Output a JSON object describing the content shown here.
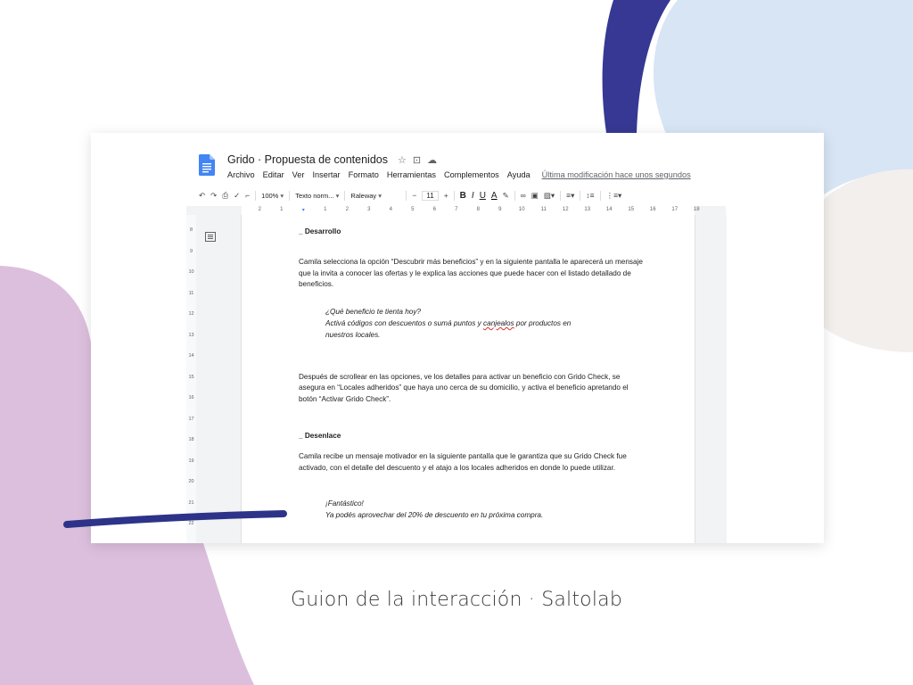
{
  "document": {
    "title": "Grido · Propuesta de contenidos",
    "title_icons": [
      "star-icon",
      "folder-icon",
      "cloud-icon"
    ],
    "menu": [
      "Archivo",
      "Editar",
      "Ver",
      "Insertar",
      "Formato",
      "Herramientas",
      "Complementos",
      "Ayuda"
    ],
    "last_modified": "Última modificación hace unos segundos"
  },
  "toolbar": {
    "zoom": "100%",
    "style": "Texto norm...",
    "font": "Raleway",
    "font_size": "11",
    "minus": "−",
    "plus": "+",
    "bold": "B",
    "italic": "I",
    "underline": "U",
    "text_color": "A"
  },
  "ruler": {
    "top": [
      "2",
      "1",
      "",
      "1",
      "2",
      "3",
      "4",
      "5",
      "6",
      "7",
      "8",
      "9",
      "10",
      "11",
      "12",
      "13",
      "14",
      "15",
      "16",
      "17",
      "18"
    ],
    "left": [
      "8",
      "9",
      "10",
      "11",
      "12",
      "13",
      "14",
      "15",
      "16",
      "17",
      "18",
      "19",
      "20",
      "21",
      "22"
    ]
  },
  "content": {
    "h_desarrollo": "_ Desarrollo",
    "p1": "Camila selecciona la opción “Descubrir más beneficios” y en la siguiente pantalla le aparecerá un mensaje que la invita a conocer las ofertas y le explica las acciones que puede hacer con el listado detallado de beneficios.",
    "q1_line1": "¿Qué beneficio te tienta hoy?",
    "q1_line2_a": " Activá códigos con descuentos o sumá puntos y ",
    "q1_line2_b": "canjealos",
    "q1_line2_c": " por productos en",
    "q1_line3": "nuestros locales.",
    "p2": "Después de scrollear en las opciones, ve los detalles para activar un beneficio con Grido Check, se asegura en “Locales adheridos” que haya uno cerca de su domicilio, y activa el beneficio apretando el botón “Activar Grido Check”.",
    "h_desenlace": "_ Desenlace",
    "p3": "Camila recibe un mensaje motivador en la siguiente pantalla que le garantiza que su Grido Check fue activado, con el detalle del descuento y el atajo a los locales adheridos en donde lo puede utilizar.",
    "q2_line1": "¡Fantástico!",
    "q2_line2": "Ya podés aprovechar del 20% de descuento en tu próxima compra."
  },
  "caption": "Guion de la interacción · Saltolab",
  "colors": {
    "blob_blue": "#363893",
    "blob_light_blue": "#d7e5f4",
    "blob_beige": "#f3efec",
    "blob_lilac": "#dcbfdd",
    "stroke": "#2d3388",
    "docs_blue": "#4285f4"
  }
}
